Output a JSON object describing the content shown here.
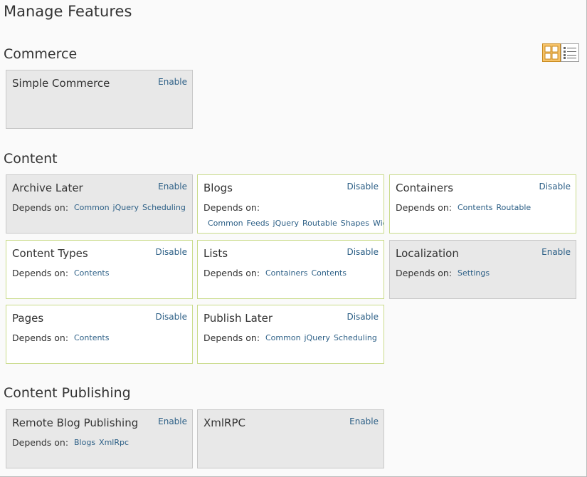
{
  "page_title": "Manage Features",
  "view_toggle": {
    "active": "tile",
    "icons": [
      "tile-view-icon",
      "list-view-icon"
    ]
  },
  "depends_label": "Depends on:",
  "sections": [
    {
      "title": "Commerce",
      "features": [
        {
          "name": "Simple Commerce",
          "action": "Enable",
          "enabled": false,
          "deps": []
        }
      ]
    },
    {
      "title": "Content",
      "features": [
        {
          "name": "Archive Later",
          "action": "Enable",
          "enabled": false,
          "deps": [
            "Common",
            "jQuery",
            "Scheduling"
          ]
        },
        {
          "name": "Blogs",
          "action": "Disable",
          "enabled": true,
          "deps": [
            "Common",
            "Feeds",
            "jQuery",
            "Routable",
            "Shapes",
            "Widgets"
          ]
        },
        {
          "name": "Containers",
          "action": "Disable",
          "enabled": true,
          "deps": [
            "Contents",
            "Routable"
          ]
        },
        {
          "name": "Content Types",
          "action": "Disable",
          "enabled": true,
          "deps": [
            "Contents"
          ]
        },
        {
          "name": "Lists",
          "action": "Disable",
          "enabled": true,
          "deps": [
            "Containers",
            "Contents"
          ]
        },
        {
          "name": "Localization",
          "action": "Enable",
          "enabled": false,
          "deps": [
            "Settings"
          ]
        },
        {
          "name": "Pages",
          "action": "Disable",
          "enabled": true,
          "deps": [
            "Contents"
          ]
        },
        {
          "name": "Publish Later",
          "action": "Disable",
          "enabled": true,
          "deps": [
            "Common",
            "jQuery",
            "Scheduling"
          ]
        }
      ]
    },
    {
      "title": "Content Publishing",
      "features": [
        {
          "name": "Remote Blog Publishing",
          "action": "Enable",
          "enabled": false,
          "deps": [
            "Blogs",
            "XmlRpc"
          ]
        },
        {
          "name": "XmlRPC",
          "action": "Enable",
          "enabled": false,
          "deps": []
        }
      ]
    }
  ],
  "colors": {
    "link": "#2c5f86",
    "enabled_border": "#c9db8a",
    "disabled_bg": "#e8e8e8",
    "toggle_active": "#f6c36a"
  }
}
